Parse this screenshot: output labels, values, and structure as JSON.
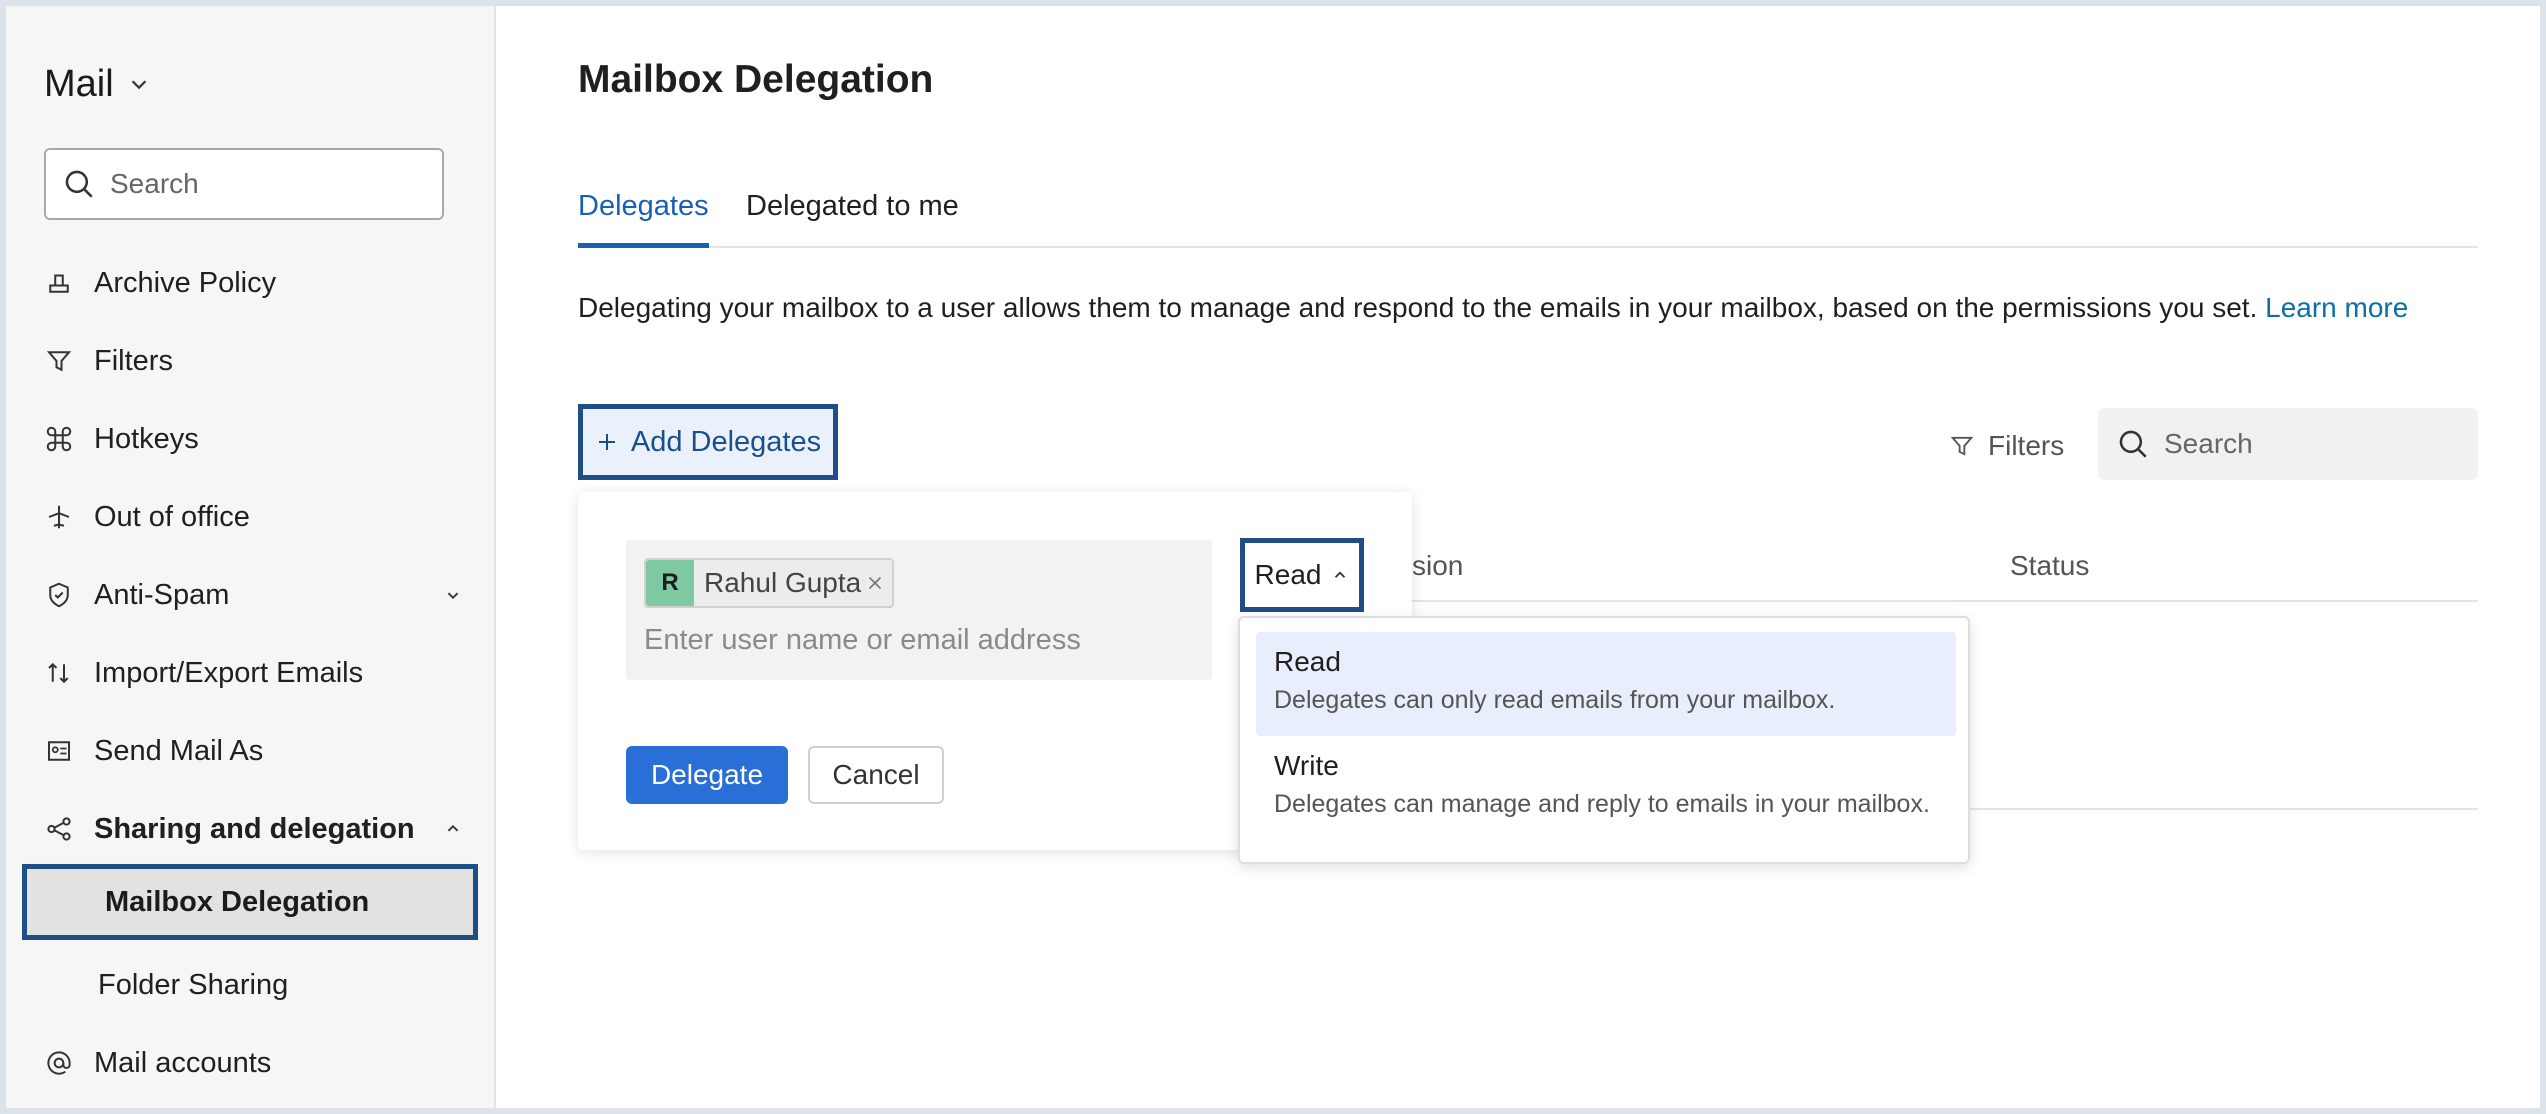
{
  "sidebar": {
    "app_title": "Mail",
    "search_placeholder": "Search",
    "items": [
      {
        "label": "Archive Policy",
        "icon": "archive-icon"
      },
      {
        "label": "Filters",
        "icon": "filter-icon"
      },
      {
        "label": "Hotkeys",
        "icon": "command-key-icon"
      },
      {
        "label": "Out of office",
        "icon": "plane-icon"
      },
      {
        "label": "Anti-Spam",
        "icon": "shield-check-icon"
      },
      {
        "label": "Import/Export Emails",
        "icon": "transfer-arrows-icon"
      },
      {
        "label": "Send Mail As",
        "icon": "id-card-icon"
      },
      {
        "label": "Sharing and delegation",
        "icon": "share-icon"
      },
      {
        "label": "Mail accounts",
        "icon": "at-sign-icon"
      }
    ],
    "sub_items": [
      "Mailbox Delegation",
      "Folder Sharing"
    ]
  },
  "main": {
    "title": "Mailbox Delegation",
    "tabs": [
      {
        "label": "Delegates",
        "active": true
      },
      {
        "label": "Delegated to me",
        "active": false
      }
    ],
    "description": "Delegating your mailbox to a user allows them to manage and respond to the emails in your mailbox, based on the permissions you set.",
    "learn_more": "Learn more",
    "add_button": "Add Delegates",
    "filters_label": "Filters",
    "search_placeholder": "Search",
    "table_headers": {
      "permission_partial": "ssion",
      "status": "Status"
    }
  },
  "popup": {
    "chip": {
      "initial": "R",
      "name": "Rahul Gupta"
    },
    "input_placeholder": "Enter user name or email address",
    "permission_value": "Read",
    "delegate_button": "Delegate",
    "cancel_button": "Cancel"
  },
  "dropdown": {
    "options": [
      {
        "title": "Read",
        "desc": "Delegates can only read emails from your mailbox.",
        "selected": true
      },
      {
        "title": "Write",
        "desc": "Delegates can manage and reply to emails in your mailbox.",
        "selected": false
      }
    ]
  },
  "colors": {
    "accent": "#1a5fb4",
    "primary_button": "#2a6ed8",
    "highlight_border": "#1f4e86",
    "avatar": "#7fc9a2",
    "link": "#0b6fa8"
  }
}
